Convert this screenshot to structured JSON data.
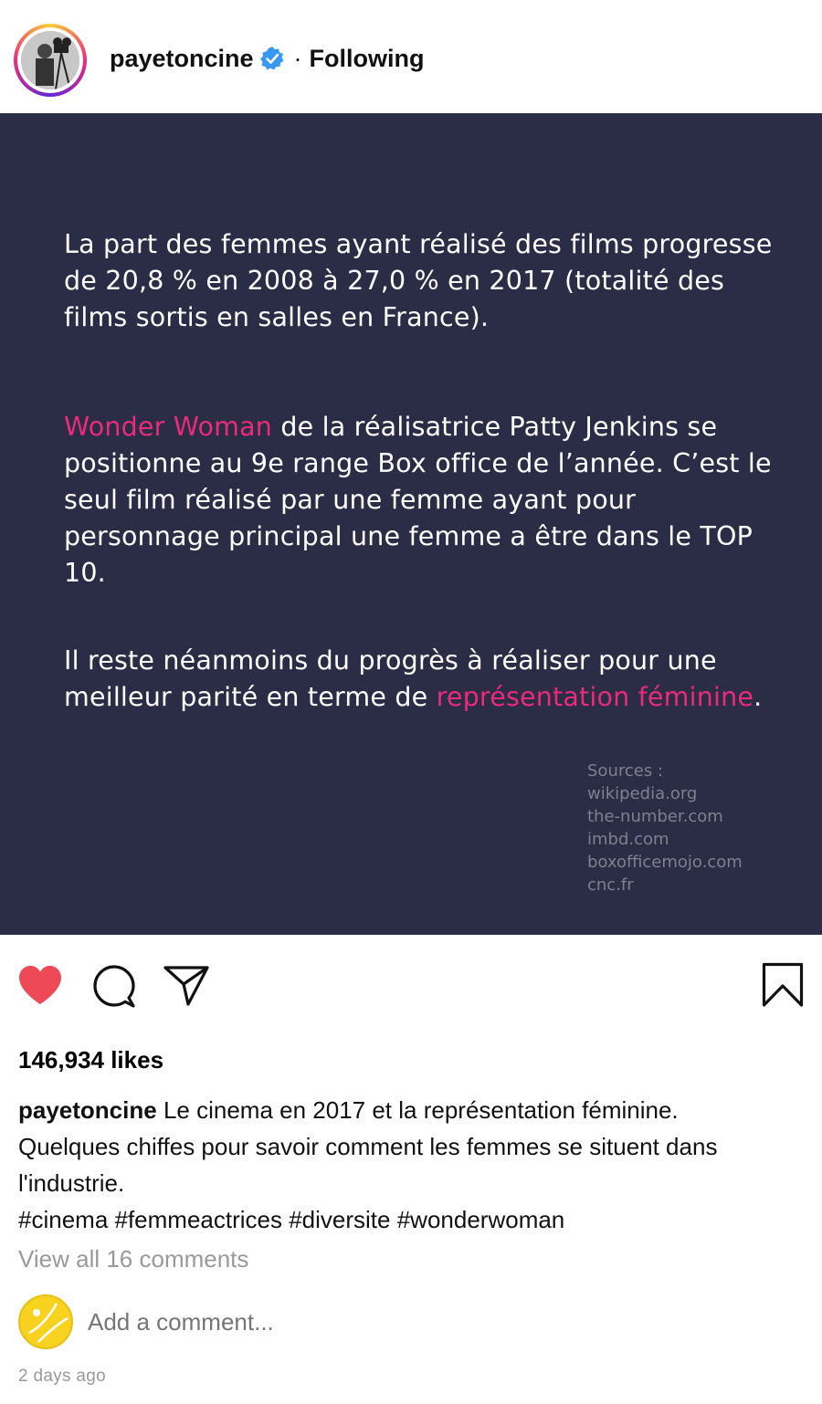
{
  "header": {
    "username": "payetoncine",
    "separator": "·",
    "follow_status": "Following",
    "verified_icon": "verified-badge-icon"
  },
  "post": {
    "paragraph1": "La part des femmes ayant réalisé des films progresse de 20,8 % en 2008 à 27,0 % en 2017 (totalité des films sortis en salles en France).",
    "paragraph2_highlight": "Wonder Woman",
    "paragraph2_rest": " de la réalisatrice Patty Jenkins se positionne au 9e range Box office de l’année. C’est le seul film réalisé par une femme ayant pour personnage principal une femme a être dans le TOP 10.",
    "paragraph3_start": "Il reste néanmoins du progrès à réaliser pour une meilleur parité en terme de ",
    "paragraph3_highlight": "représentation féminine",
    "paragraph3_end": ".",
    "sources": [
      "Sources :",
      "wikipedia.org",
      "the-number.com",
      "imbd.com",
      "boxofficemojo.com",
      "cnc.fr"
    ],
    "colors": {
      "background": "#2b2c45",
      "highlight": "#ea2b7d",
      "text": "#ffffff"
    }
  },
  "actions": {
    "like_icon": "heart-icon",
    "comment_icon": "comment-icon",
    "share_icon": "share-icon",
    "save_icon": "bookmark-icon",
    "like_color": "#ed4956"
  },
  "likes_text": "146,934 likes",
  "caption": {
    "username": "payetoncine",
    "text": "Le cinema en 2017 et la représentation féminine.",
    "line2": "Quelques chiffes pour savoir comment les femmes se situent dans l'industrie.",
    "hashtags": "#cinema #femmeactrices #diversite #wonderwoman"
  },
  "view_comments": "View all 16 comments",
  "comment_placeholder": "Add a comment...",
  "timestamp": "2 days ago"
}
